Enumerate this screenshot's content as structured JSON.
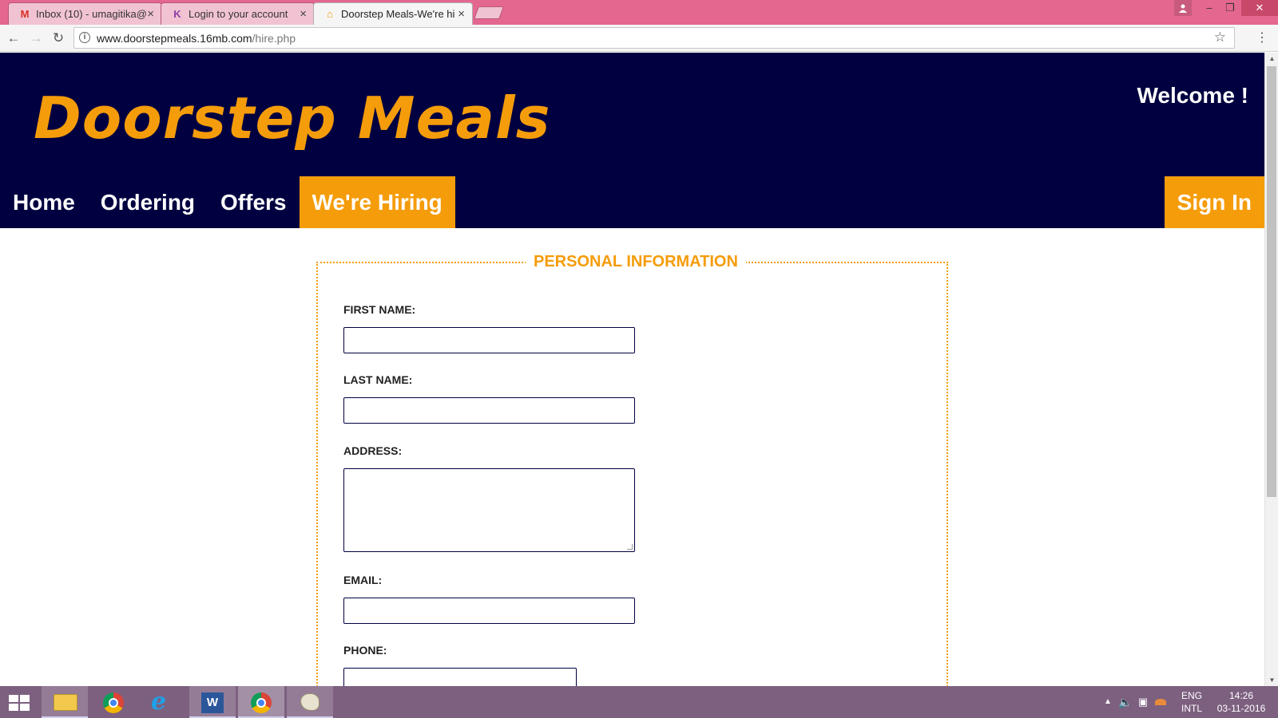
{
  "browser": {
    "tabs": [
      {
        "label": "Inbox (10) - umagitika@",
        "favicon": "gmail-icon",
        "favicon_glyph": "M"
      },
      {
        "label": "Login to your account",
        "favicon": "site-icon",
        "favicon_glyph": "K"
      },
      {
        "label": "Doorstep Meals-We're hi",
        "favicon": "home-icon",
        "favicon_glyph": "⌂"
      }
    ],
    "active_tab": 2,
    "url_host": "www.doorstepmeals.16mb.com",
    "url_path": "/hire.php"
  },
  "site": {
    "logo": "Doorstep Meals",
    "welcome": "Welcome !",
    "nav": [
      "Home",
      "Ordering",
      "Offers",
      "We're Hiring"
    ],
    "active_nav": 3,
    "signin": "Sign In"
  },
  "form": {
    "legend": "PERSONAL INFORMATION",
    "first_name_label": "FIRST NAME:",
    "last_name_label": "LAST NAME:",
    "address_label": "ADDRESS:",
    "email_label": "EMAIL:",
    "phone_label": "PHONE:",
    "first_name_value": "",
    "last_name_value": "",
    "address_value": "",
    "email_value": "",
    "phone_value": ""
  },
  "taskbar": {
    "apps": [
      "file-explorer-icon",
      "chrome-icon",
      "internet-explorer-icon",
      "word-icon",
      "chrome-icon",
      "paint-icon"
    ],
    "language_top": "ENG",
    "language_bottom": "INTL",
    "time": "14:26",
    "date": "03-11-2016"
  },
  "colors": {
    "header_bg": "#000040",
    "accent": "#f59c0a",
    "browser_frame": "#e4678f",
    "taskbar": "#7d6080"
  }
}
